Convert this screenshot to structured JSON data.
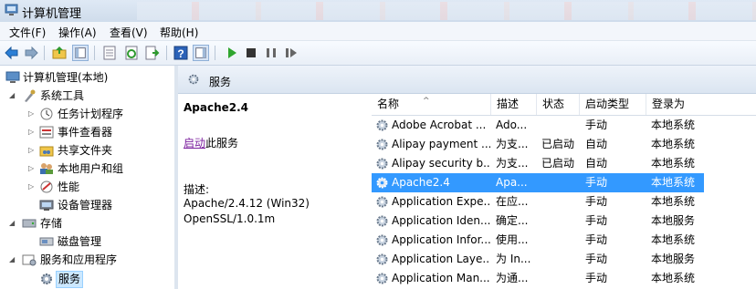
{
  "window": {
    "title": "计算机管理"
  },
  "menu": [
    {
      "label": "文件(F)"
    },
    {
      "label": "操作(A)"
    },
    {
      "label": "查看(V)"
    },
    {
      "label": "帮助(H)"
    }
  ],
  "toolbar": {
    "icons": [
      "back-arrow-icon",
      "forward-arrow-icon",
      "up-folder-icon",
      "show-hide-tree-icon",
      "properties-icon",
      "refresh-icon",
      "export-list-icon",
      "help-icon",
      "show-hide-action-pane-icon",
      "play-icon",
      "stop-icon",
      "pause-icon",
      "resume-icon"
    ]
  },
  "tree": {
    "root": "计算机管理(本地)",
    "system_tools": "系统工具",
    "task_scheduler": "任务计划程序",
    "event_viewer": "事件查看器",
    "shared_folders": "共享文件夹",
    "local_users": "本地用户和组",
    "performance": "性能",
    "device_manager": "设备管理器",
    "storage": "存储",
    "disk_management": "磁盘管理",
    "services_apps": "服务和应用程序",
    "services": "服务"
  },
  "header": {
    "title": "服务"
  },
  "detail": {
    "name": "Apache2.4",
    "start_link": "启动",
    "start_rest": "此服务",
    "desc_label": "描述:",
    "desc_line1": "Apache/2.4.12 (Win32)",
    "desc_line2": "OpenSSL/1.0.1m"
  },
  "columns": [
    "名称",
    "描述",
    "状态",
    "启动类型",
    "登录为"
  ],
  "rows": [
    {
      "name": "Adobe Acrobat ...",
      "desc": "Ado...",
      "status": "",
      "startup": "手动",
      "logon": "本地系统"
    },
    {
      "name": "Alipay payment ...",
      "desc": "为支...",
      "status": "已启动",
      "startup": "自动",
      "logon": "本地系统"
    },
    {
      "name": "Alipay security b...",
      "desc": "为支...",
      "status": "已启动",
      "startup": "自动",
      "logon": "本地系统"
    },
    {
      "name": "Apache2.4",
      "desc": "Apa...",
      "status": "",
      "startup": "手动",
      "logon": "本地系统"
    },
    {
      "name": "Application Expe...",
      "desc": "在应...",
      "status": "",
      "startup": "手动",
      "logon": "本地系统"
    },
    {
      "name": "Application Iden...",
      "desc": "确定...",
      "status": "",
      "startup": "手动",
      "logon": "本地服务"
    },
    {
      "name": "Application Infor...",
      "desc": "使用...",
      "status": "",
      "startup": "手动",
      "logon": "本地系统"
    },
    {
      "name": "Application Laye...",
      "desc": "为 In...",
      "status": "",
      "startup": "手动",
      "logon": "本地服务"
    },
    {
      "name": "Application Man...",
      "desc": "为通...",
      "status": "",
      "startup": "手动",
      "logon": "本地系统"
    }
  ],
  "selected_row_color": "#3399ff"
}
